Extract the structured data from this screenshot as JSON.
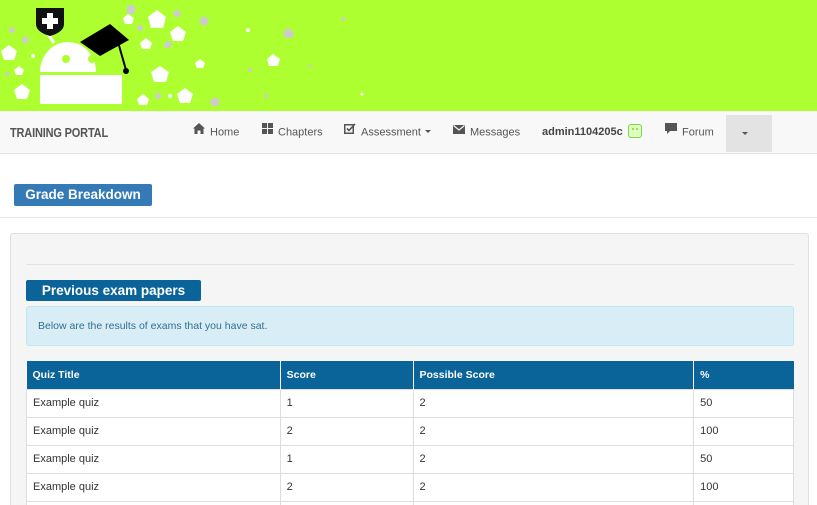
{
  "brand": {
    "name": "TRAINING PORTAL",
    "banner_color": "#adff2f"
  },
  "nav": {
    "home": {
      "label": "Home",
      "icon": "home-icon"
    },
    "chapters": {
      "label": "Chapters",
      "icon": "grid-icon"
    },
    "assessment": {
      "label": "Assessment",
      "icon": "checkbox-icon"
    },
    "messages": {
      "label": "Messages",
      "icon": "envelope-icon"
    },
    "user": {
      "label": "admin1104205c",
      "icon": "user-badge-icon"
    },
    "forum": {
      "label": "Forum",
      "icon": "comment-icon"
    }
  },
  "page": {
    "title": "Grade Breakdown"
  },
  "exams": {
    "heading": "Previous exam papers",
    "info": "Below are the results of exams that you have sat.",
    "columns": [
      "Quiz Title",
      "Score",
      "Possible Score",
      "%"
    ],
    "rows": [
      [
        "Example quiz",
        "1",
        "2",
        "50"
      ],
      [
        "Example quiz",
        "2",
        "2",
        "100"
      ],
      [
        "Example quiz",
        "1",
        "2",
        "50"
      ],
      [
        "Example quiz",
        "2",
        "2",
        "100"
      ],
      [
        "",
        "",
        "",
        ""
      ]
    ]
  },
  "colors": {
    "primary": "#337ab7",
    "table_header": "#0a6399",
    "info_bg": "#d9edf7"
  }
}
